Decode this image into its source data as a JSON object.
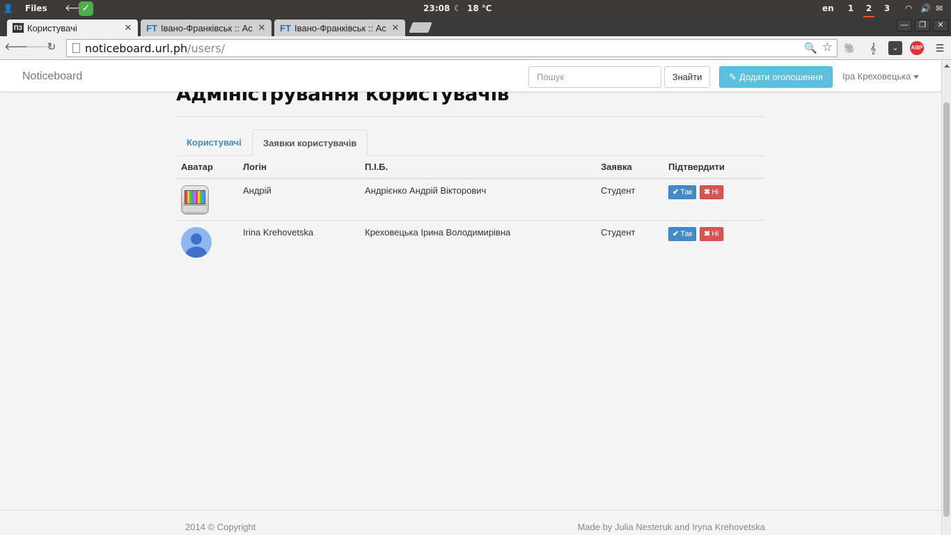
{
  "os_panel": {
    "files_label": "Files",
    "clock": "23:08",
    "temperature": "18 ℃",
    "language": "en",
    "workspaces": [
      "1",
      "2",
      "3"
    ],
    "active_workspace": "2"
  },
  "browser": {
    "tabs": [
      {
        "title": "Користувачі",
        "favicon": "ПЗ"
      },
      {
        "title": "Івано-Франківськ :: Ас",
        "favicon": "FT"
      },
      {
        "title": "Івано-Франківськ :: Ас",
        "favicon": "FT"
      }
    ],
    "url_host": "noticeboard.url.ph",
    "url_path": "/users/"
  },
  "navbar": {
    "brand": "Noticeboard",
    "search_placeholder": "Пошук",
    "search_button": "Знайти",
    "add_button": "Додати оголошення",
    "user_name": "Іра Креховецька"
  },
  "page": {
    "title": "Адміністрування користувачів",
    "tabs": [
      {
        "label": "Користувачі"
      },
      {
        "label": "Заявки користувачів"
      }
    ],
    "table": {
      "headers": [
        "Аватар",
        "Логін",
        "П.І.Б.",
        "Заявка",
        "Підтвердити"
      ],
      "rows": [
        {
          "login": "Андрій",
          "full_name": "Андрієнко Андрій Вікторович",
          "request": "Студент",
          "yes": "Так",
          "no": "Ні",
          "avatar": "keyboard-avatar"
        },
        {
          "login": "Irina Krehovetska",
          "full_name": "Креховецька Ірина Володимирівна",
          "request": "Студент",
          "yes": "Так",
          "no": "Ні",
          "avatar": "person-avatar"
        }
      ]
    }
  },
  "footer": {
    "copyright": "2014 © Copyright",
    "credits": "Made by Julia Nesteruk and Iryna Krehovetska"
  },
  "colors": {
    "primary": "#428bca",
    "info": "#5bc0de",
    "danger": "#d9534f",
    "panel": "#3c3b37"
  }
}
